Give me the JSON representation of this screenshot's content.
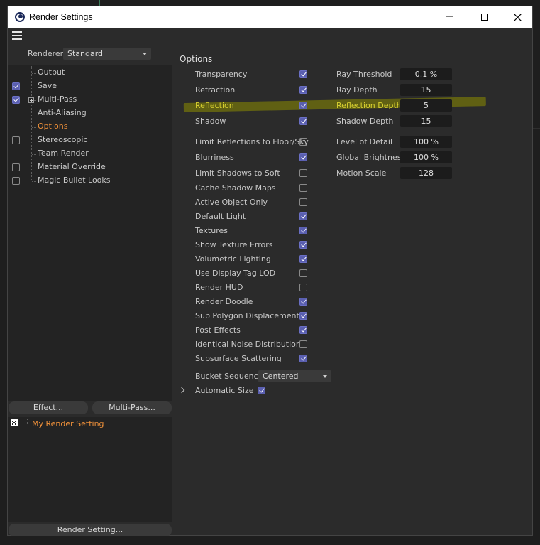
{
  "window": {
    "title": "Render Settings"
  },
  "left": {
    "renderer_label": "Renderer",
    "renderer_value": "Standard",
    "tree": [
      {
        "label": "Output",
        "checkbox": null,
        "expand": false,
        "active": false
      },
      {
        "label": "Save",
        "checkbox": true,
        "expand": false,
        "active": false
      },
      {
        "label": "Multi-Pass",
        "checkbox": true,
        "expand": true,
        "active": false
      },
      {
        "label": "Anti-Aliasing",
        "checkbox": null,
        "expand": false,
        "active": false
      },
      {
        "label": "Options",
        "checkbox": null,
        "expand": false,
        "active": true
      },
      {
        "label": "Stereoscopic",
        "checkbox": false,
        "expand": false,
        "active": false
      },
      {
        "label": "Team Render",
        "checkbox": null,
        "expand": false,
        "active": false
      },
      {
        "label": "Material Override",
        "checkbox": false,
        "expand": false,
        "active": false
      },
      {
        "label": "Magic Bullet Looks",
        "checkbox": false,
        "expand": false,
        "active": false
      }
    ],
    "effect_button": "Effect...",
    "multipass_button": "Multi-Pass...",
    "setting_name": "My Render Setting",
    "render_setting_button": "Render Setting..."
  },
  "options": {
    "title": "Options",
    "group1": [
      {
        "label": "Transparency",
        "checked": true,
        "highlight": false
      },
      {
        "label": "Refraction",
        "checked": true,
        "highlight": false
      },
      {
        "label": "Reflection",
        "checked": true,
        "highlight": true
      },
      {
        "label": "Shadow",
        "checked": true,
        "highlight": false
      }
    ],
    "group1_fields": [
      {
        "label": "Ray Threshold",
        "value": "0.1 %",
        "highlight": false
      },
      {
        "label": "Ray Depth",
        "value": "15",
        "highlight": false
      },
      {
        "label": "Reflection Depth",
        "value": "5",
        "highlight": true
      },
      {
        "label": "Shadow Depth",
        "value": "15",
        "highlight": false
      }
    ],
    "group2": [
      {
        "label": "Limit Reflections to Floor/Sky",
        "checked": false
      },
      {
        "label": "Blurriness",
        "checked": true
      },
      {
        "label": "Limit Shadows to Soft",
        "checked": false
      },
      {
        "label": "Cache Shadow Maps",
        "checked": false
      },
      {
        "label": "Active Object Only",
        "checked": false
      },
      {
        "label": "Default Light",
        "checked": true
      },
      {
        "label": "Textures",
        "checked": true
      },
      {
        "label": "Show Texture Errors",
        "checked": true
      },
      {
        "label": "Volumetric Lighting",
        "checked": true
      },
      {
        "label": "Use Display Tag LOD",
        "checked": false
      },
      {
        "label": "Render HUD",
        "checked": false
      },
      {
        "label": "Render Doodle",
        "checked": true
      },
      {
        "label": "Sub Polygon Displacement",
        "checked": true
      },
      {
        "label": "Post Effects",
        "checked": true
      },
      {
        "label": "Identical Noise Distribution",
        "checked": false
      },
      {
        "label": "Subsurface Scattering",
        "checked": true
      }
    ],
    "group2_fields": [
      {
        "label": "Level of Detail",
        "value": "100 %"
      },
      {
        "label": "Global Brightness",
        "value": "100 %"
      },
      {
        "label": "Motion Scale",
        "value": "128"
      }
    ],
    "bucket_label": "Bucket Sequence",
    "bucket_value": "Centered",
    "auto_size_label": "Automatic Size",
    "auto_size_checked": true
  },
  "colors": {
    "accent": "#f0913a",
    "highlight": "#d8d030",
    "checkbox": "#5a5fb0"
  }
}
